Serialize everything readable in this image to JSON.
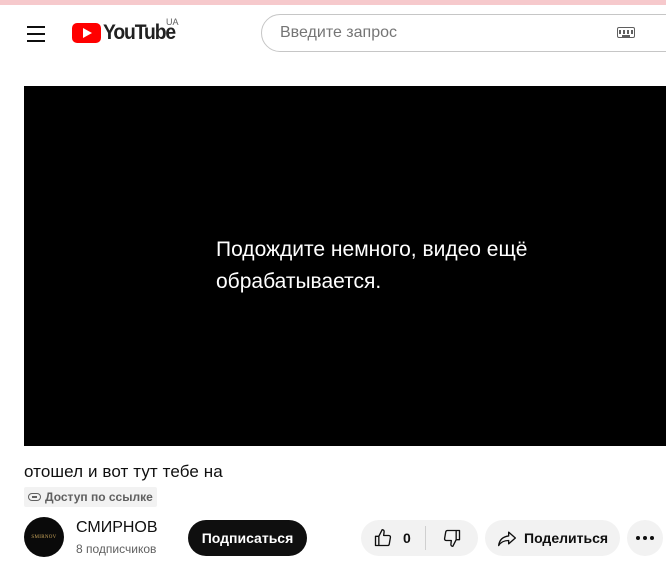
{
  "masthead": {
    "logo_text": "YouTube",
    "country_code": "UA",
    "search_placeholder": "Введите запрос",
    "search_value": ""
  },
  "player": {
    "message": "Подождите немного, видео ещё обрабатывается."
  },
  "video": {
    "title": "отошел и вот тут тебе на",
    "visibility": "Доступ по ссылке"
  },
  "owner": {
    "avatar_text": "SMIRNOV",
    "channel_name": "СМИРНОВ",
    "subscriber_count": "8 подписчиков",
    "subscribe_label": "Подписаться"
  },
  "actions": {
    "like_count": "0",
    "share_label": "Поделиться"
  },
  "icons": {
    "menu": "menu-icon",
    "keyboard": "keyboard-icon",
    "link": "link-icon",
    "like": "thumb-up-icon",
    "dislike": "thumb-down-icon",
    "share": "share-icon",
    "more": "more-horizontal-icon"
  },
  "colors": {
    "brand_red": "#ff0000",
    "top_bar": "#f6c9cc",
    "button_dark": "#0f0f0f",
    "chip_gray": "#f2f2f2"
  }
}
